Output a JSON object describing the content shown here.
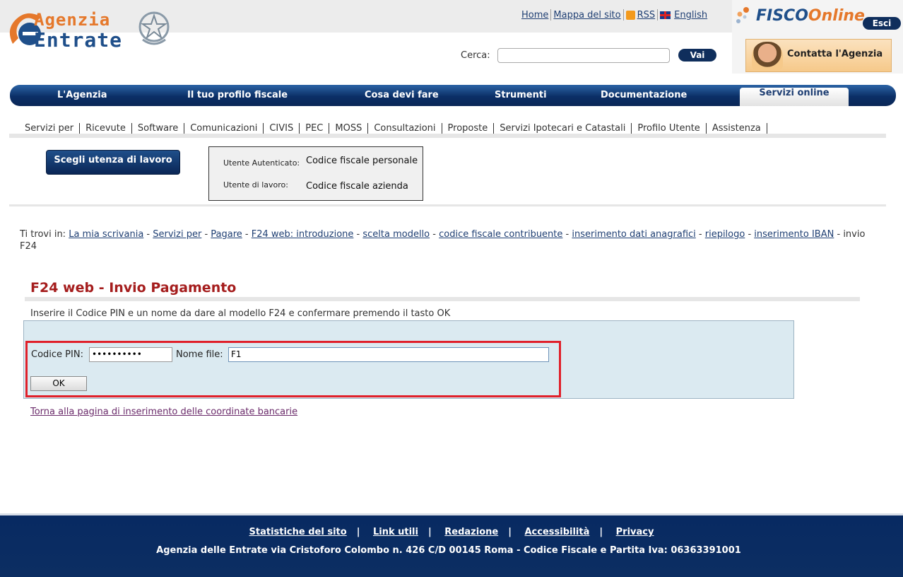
{
  "header": {
    "logo_line1": "Agenzia",
    "logo_line2": "Entrate",
    "links": [
      "Home",
      "Mappa del sito",
      "RSS",
      "English"
    ],
    "fisco_logo_a": "FISCO",
    "fisco_logo_b": "nline",
    "esci_label": "Esci",
    "contatta_label": "Contatta l'Agenzia",
    "search": {
      "label": "Cerca:",
      "value": "",
      "button_label": "Vai"
    }
  },
  "main_nav": {
    "items": [
      "L'Agenzia",
      "Il tuo profilo fiscale",
      "Cosa devi fare",
      "Strumenti",
      "Documentazione"
    ],
    "active_item": "Servizi online"
  },
  "sub_nav": {
    "items": [
      "Servizi per",
      "Ricevute",
      "Software",
      "Comunicazioni",
      "CIVIS",
      "PEC",
      "MOSS",
      "Consultazioni",
      "Proposte",
      "Servizi Ipotecari e Catastali",
      "Profilo Utente",
      "Assistenza"
    ]
  },
  "user_panel": {
    "scegli_button": "Scegli utenza di lavoro",
    "authenticated_label": "Utente Autenticato:",
    "authenticated_value": "Codice fiscale personale",
    "work_label": "Utente di lavoro:",
    "work_value": "Codice fiscale azienda"
  },
  "breadcrumb": {
    "prefix": "Ti trovi in:",
    "links": [
      "La mia scrivania",
      "Servizi per",
      "Pagare",
      "F24 web: introduzione",
      "scelta modello",
      "codice fiscale contribuente",
      "inserimento dati anagrafici",
      "riepilogo",
      "inserimento IBAN"
    ],
    "current": "invio F24"
  },
  "content": {
    "title": "F24 web - Invio Pagamento",
    "instructions": "Inserire il Codice PIN e un nome da dare al modello F24 e confermare premendo il tasto OK",
    "pin_label": "Codice PIN:",
    "pin_value": "••••••••••",
    "file_label": "Nome file:",
    "file_value": "F1",
    "ok_label": "OK",
    "back_link": "Torna alla pagina di inserimento delle coordinate bancarie"
  },
  "footer": {
    "links": [
      "Statistiche del sito",
      "Link utili",
      "Redazione",
      "Accessibilità",
      "Privacy"
    ],
    "address": "Agenzia delle Entrate via Cristoforo Colombo n. 426 C/D 00145 Roma - Codice Fiscale e Partita Iva: 06363391001"
  },
  "colors": {
    "nav_blue": "#0b2f66",
    "title_red": "#a51d1d",
    "highlight_red": "#e0202a",
    "panel_blue": "#dbeaf1",
    "brand_orange": "#e5782b"
  }
}
